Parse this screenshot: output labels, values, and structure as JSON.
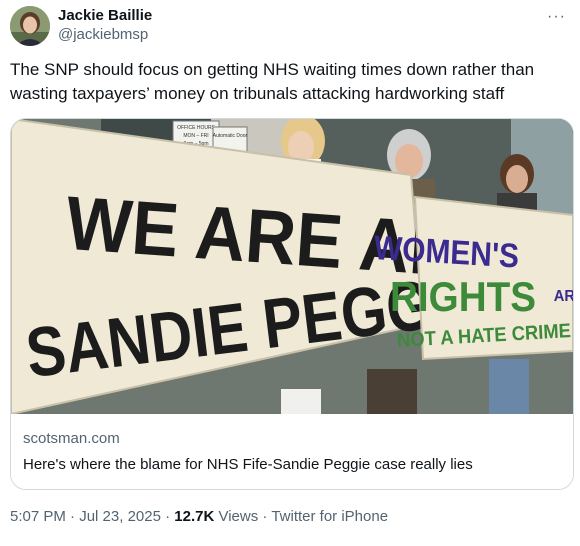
{
  "author": {
    "display_name": "Jackie Baillie",
    "handle": "@jackiebmsp"
  },
  "more_icon": "more-horizontal-icon",
  "tweet_text": "The SNP should focus on getting NHS waiting times down rather than wasting taxpayers’ money on tribunals attacking hardworking staff",
  "card": {
    "banner_left_line1": "WE ARE ALL",
    "banner_left_line2": "SANDIE PEGGIE",
    "banner_right_line1": "WOMEN'S",
    "banner_right_line2": "RIGHTS",
    "banner_right_line2b": "ARE",
    "banner_right_line3": "NOT A HATE CRIME",
    "sign_line1": "OFFICE HOURS",
    "sign_line2": "MON – FRI",
    "sign_line3": "9am – 5pm",
    "door_sign": "Automatic Door",
    "domain": "scotsman.com",
    "title": "Here's where the blame for NHS Fife-Sandie Peggie case really lies"
  },
  "footer": {
    "time": "5:07 PM",
    "sep1": " · ",
    "date": "Jul 23, 2025",
    "sep2": " · ",
    "views_count": "12.7K",
    "views_label": " Views",
    "sep3": " · ",
    "source": "Twitter for iPhone"
  },
  "colors": {
    "banner_green": "#3d8a3a",
    "banner_purple": "#3b2a8f",
    "banner_cloth": "#efe9d6",
    "text_secondary": "#536471"
  }
}
